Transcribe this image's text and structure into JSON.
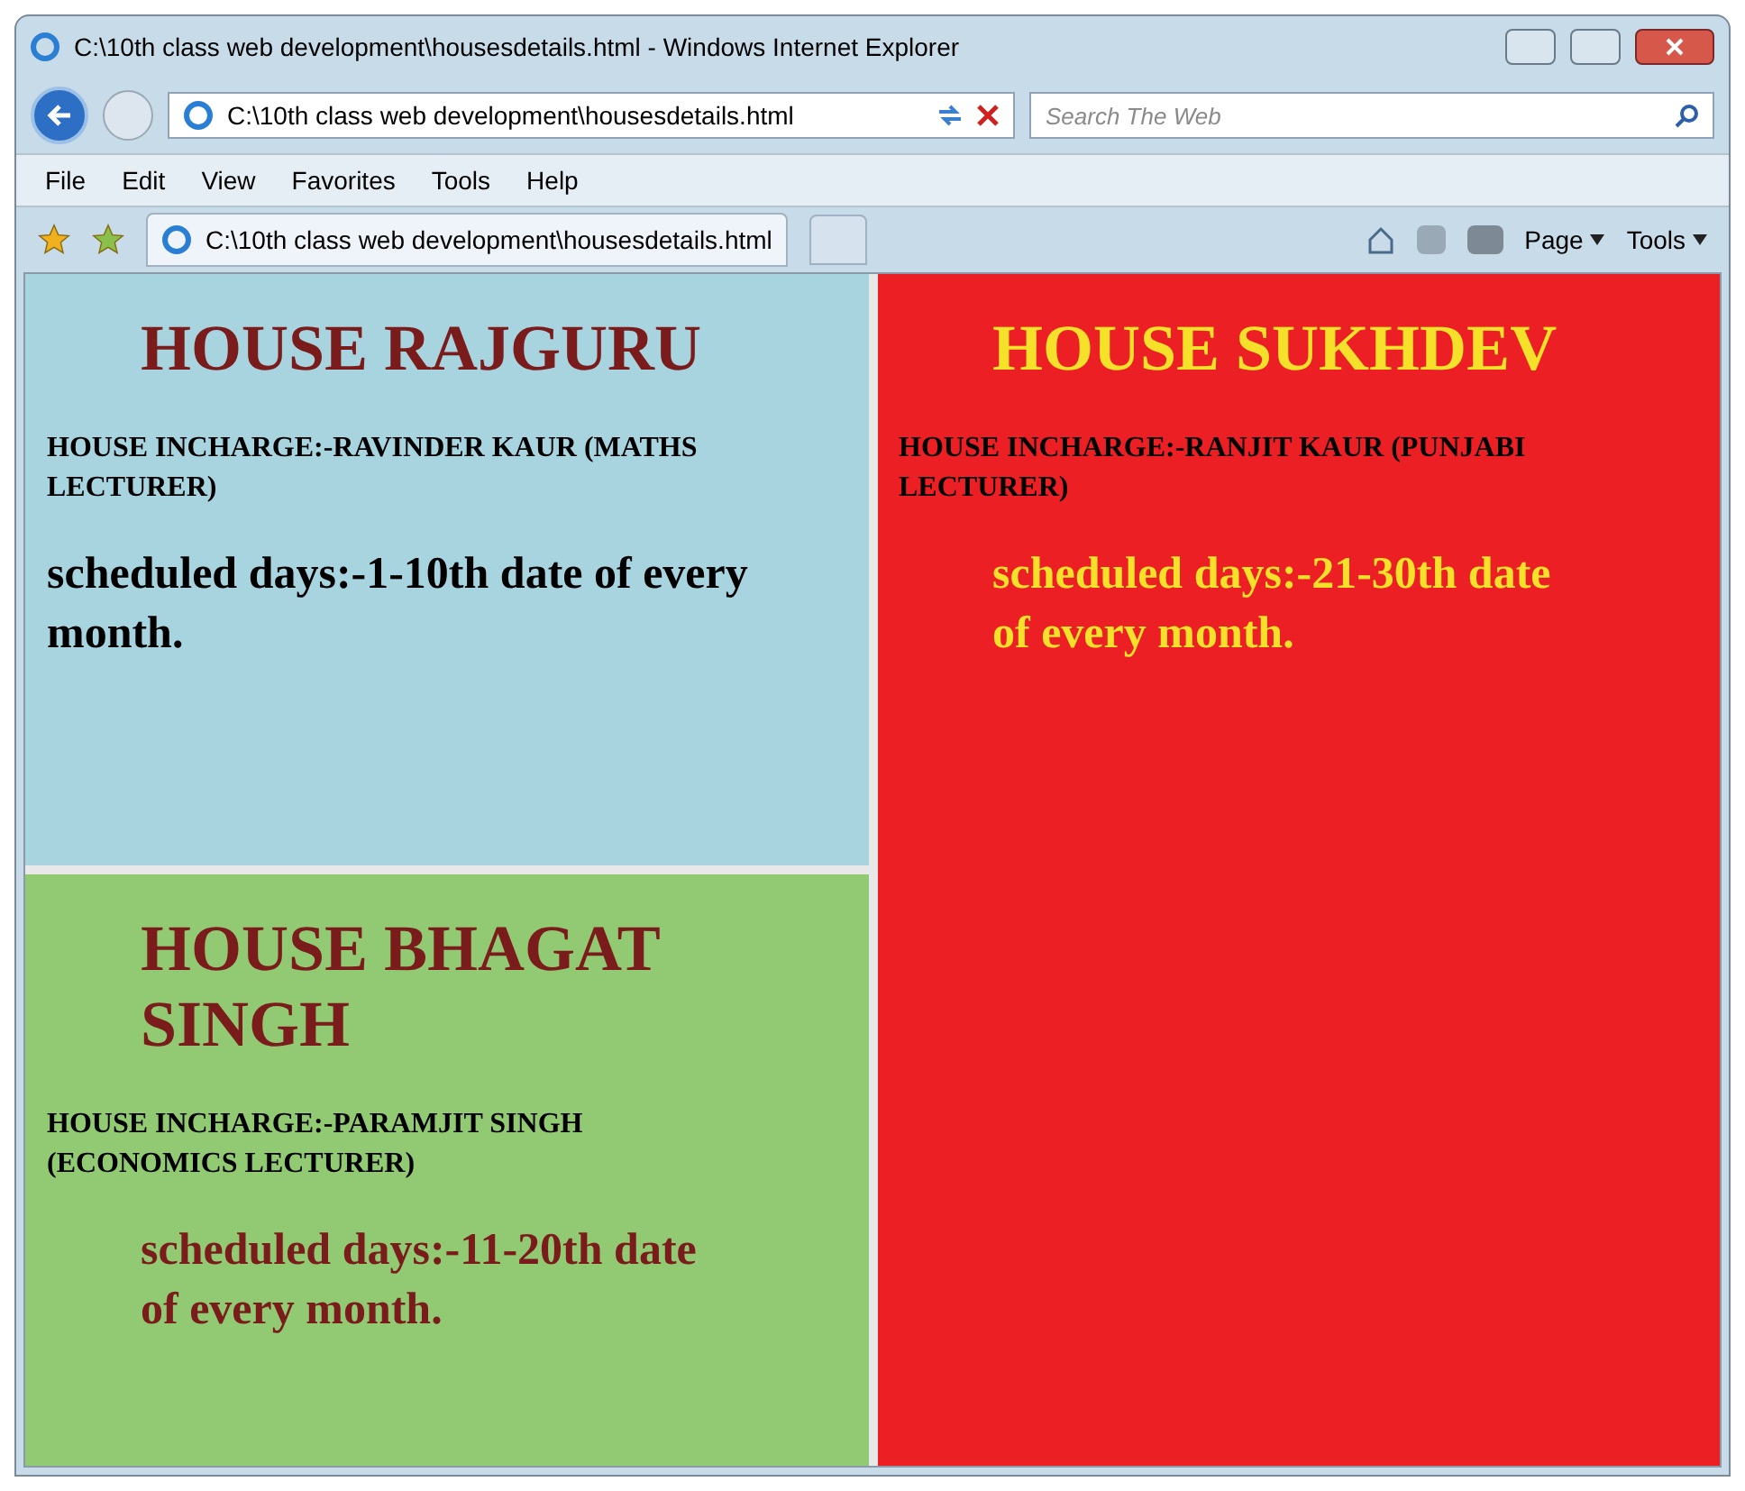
{
  "window": {
    "title": "C:\\10th class web development\\housesdetails.html - Windows Internet Explorer"
  },
  "address_bar": {
    "value": "C:\\10th class web development\\housesdetails.html"
  },
  "search": {
    "placeholder": "Search The Web"
  },
  "menu": [
    "File",
    "Edit",
    "View",
    "Favorites",
    "Tools",
    "Help"
  ],
  "tab": {
    "label": "C:\\10th class web development\\housesdetails.html"
  },
  "command_bar": [
    "Page",
    "Tools"
  ],
  "panels": [
    {
      "title": "HOUSE RAJGURU",
      "incharge": "HOUSE INCHARGE:-RAVINDER KAUR (MATHS LECTURER)",
      "schedule": "scheduled days:-1-10th date of every month.",
      "color": "#a8d4e0",
      "kind": "blue",
      "schedule_indented": false
    },
    {
      "title": "HOUSE SUKHDEV",
      "incharge": "HOUSE INCHARGE:-RANJIT KAUR (PUNJABI LECTURER)",
      "schedule": "scheduled days:-21-30th date of every month.",
      "color": "#ec1f24",
      "kind": "red",
      "schedule_indented": true
    },
    {
      "title": "HOUSE BHAGAT SINGH",
      "incharge": "HOUSE INCHARGE:-PARAMJIT SINGH (ECONOMICS LECTURER)",
      "schedule": "scheduled days:-11-20th date of every month.",
      "color": "#92c973",
      "kind": "green",
      "schedule_indented": true
    }
  ]
}
